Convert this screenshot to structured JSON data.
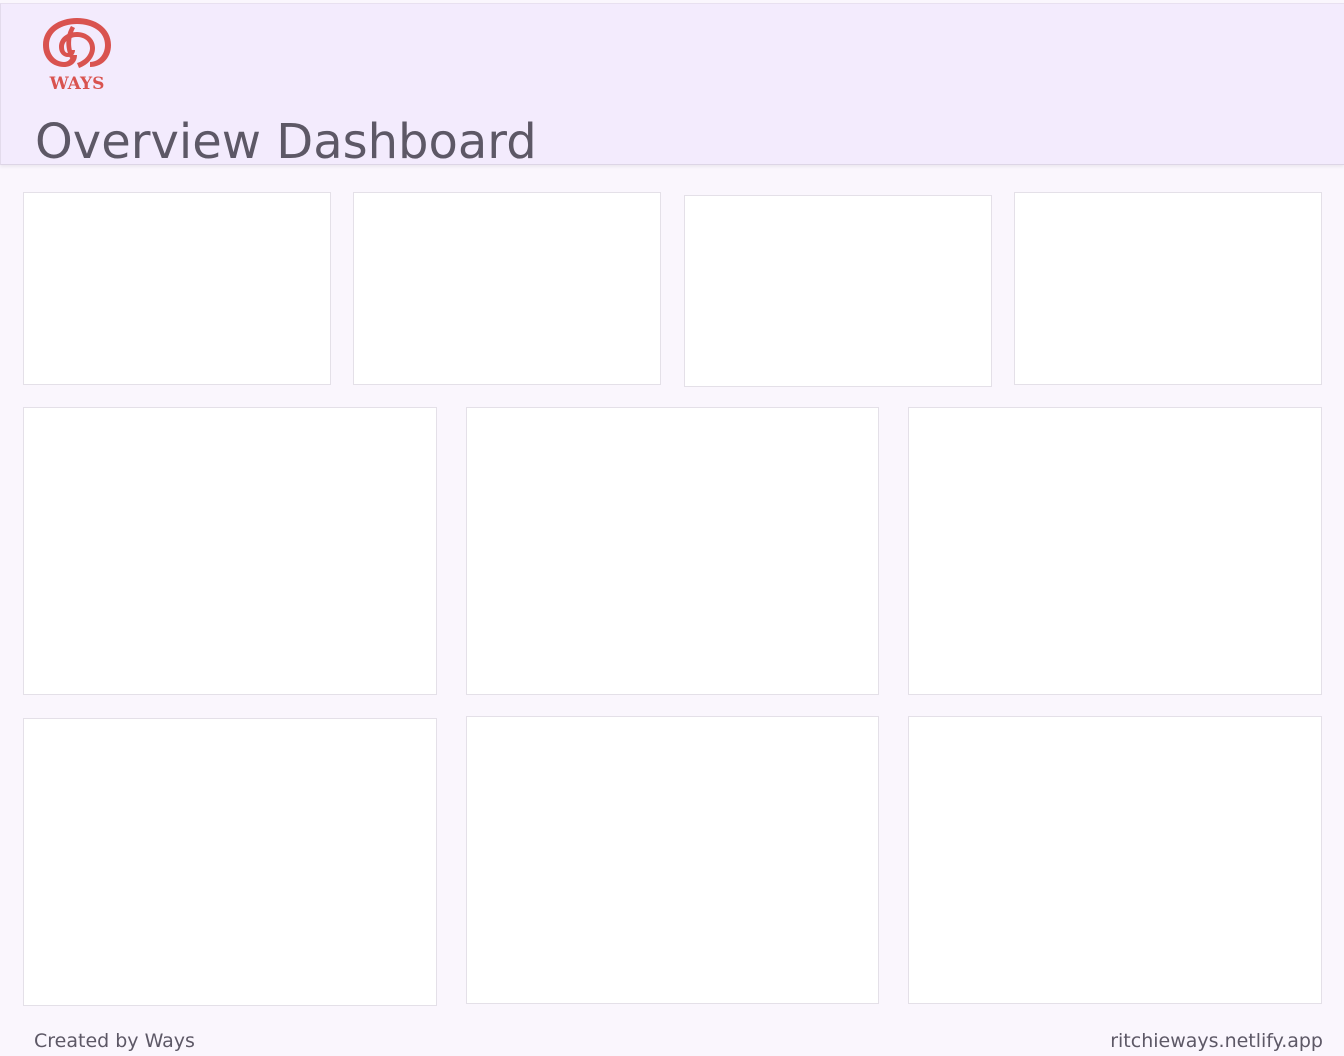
{
  "header": {
    "logo_text": "WAYS",
    "title": "Overview Dashboard"
  },
  "colors": {
    "header_background": "#f3ebfd",
    "page_background": "#faf6fd",
    "card_background": "#ffffff",
    "logo_red": "#d9534f",
    "text": "#5d5866"
  },
  "icons": {
    "logo": "ways-logo-icon"
  },
  "footer": {
    "credit": "Created by Ways",
    "url": "ritchieways.netlify.app"
  }
}
